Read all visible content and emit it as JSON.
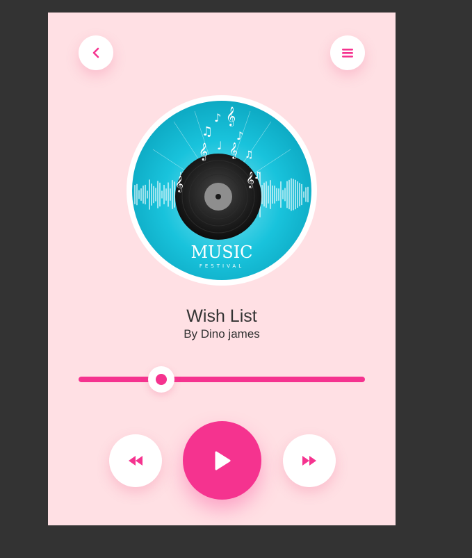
{
  "song": {
    "title": "Wish List",
    "artist": "By Dino james"
  },
  "cover": {
    "brand_text": "MUSIC",
    "brand_subtext": "FESTIVAL"
  },
  "playback": {
    "progress": 0.29
  },
  "icons": {
    "back": "chevron-left-icon",
    "menu": "hamburger-menu-icon",
    "previous": "rewind-icon",
    "play": "play-icon",
    "next": "fast-forward-icon"
  },
  "colors": {
    "accent": "#f5338f",
    "background": "#ffe0e4",
    "frame": "#333333",
    "card": "#ffffff"
  }
}
